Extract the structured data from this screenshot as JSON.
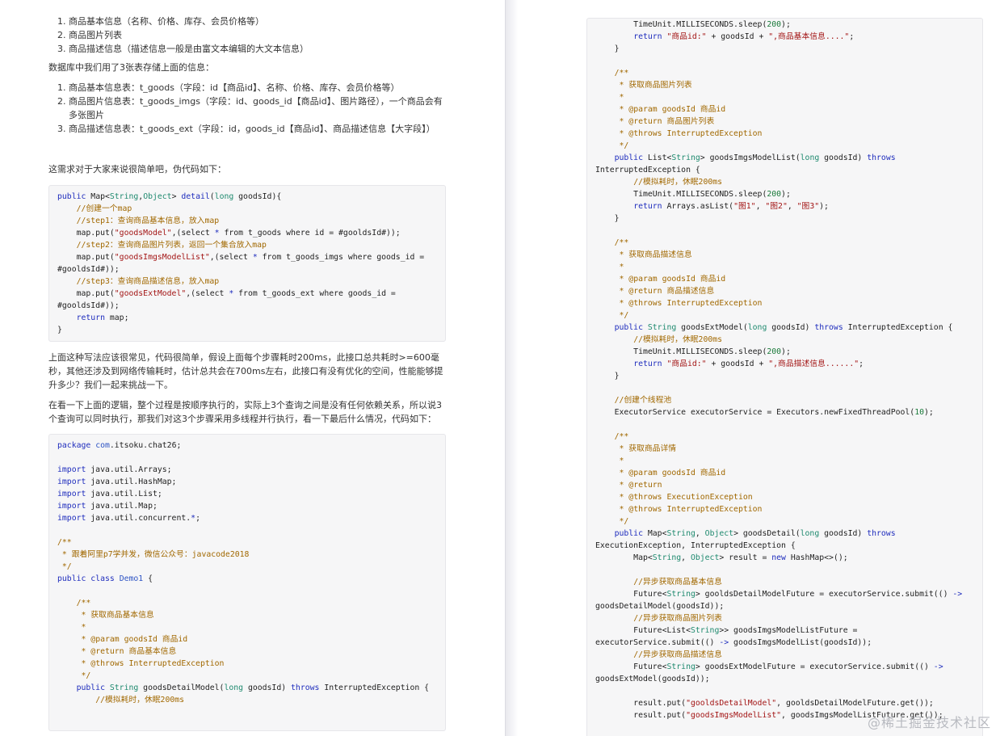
{
  "left": {
    "list1": [
      "商品基本信息（名称、价格、库存、会员价格等）",
      "商品图片列表",
      "商品描述信息（描述信息一般是由富文本编辑的大文本信息）"
    ],
    "db_intro": "数据库中我们用了3张表存储上面的信息：",
    "list2": [
      "商品基本信息表：t_goods（字段：id【商品id】、名称、价格、库存、会员价格等）",
      "商品图片信息表：t_goods_imgs（字段：id、goods_id【商品id】、图片路径），一个商品会有多张图片",
      "商品描述信息表：t_goods_ext（字段：id，goods_id【商品id】、商品描述信息【大字段】）"
    ],
    "simple_intro": "这需求对于大家来说很简单吧，伪代码如下：",
    "code1": [
      [
        [
          "kw",
          "public "
        ],
        [
          "",
          "Map<"
        ],
        [
          "ty",
          "String"
        ],
        [
          "",
          ","
        ],
        [
          "ty",
          "Object"
        ],
        [
          "",
          "> "
        ],
        [
          "kw",
          "detail"
        ],
        [
          "",
          "("
        ],
        [
          "ty",
          "long"
        ],
        [
          "",
          " goodsId){"
        ]
      ],
      [
        [
          "",
          "    "
        ],
        [
          "cm",
          "//创建一个map"
        ]
      ],
      [
        [
          "",
          "    "
        ],
        [
          "cm",
          "//step1：查询商品基本信息，放入map"
        ]
      ],
      [
        [
          "",
          "    map.put("
        ],
        [
          "st",
          "\"goodsModel\""
        ],
        [
          "",
          ",(select "
        ],
        [
          "kw",
          "*"
        ],
        [
          "",
          " from t_goods where id = #gooldsId#));"
        ]
      ],
      [
        [
          "",
          "    "
        ],
        [
          "cm",
          "//step2：查询商品图片列表，返回一个集合放入map"
        ]
      ],
      [
        [
          "",
          "    map.put("
        ],
        [
          "st",
          "\"goodsImgsModelList\""
        ],
        [
          "",
          ",(select "
        ],
        [
          "kw",
          "*"
        ],
        [
          "",
          " from t_goods_imgs where goods_id ="
        ]
      ],
      [
        [
          "",
          "#gooldsId#));"
        ]
      ],
      [
        [
          "",
          "    "
        ],
        [
          "cm",
          "//step3：查询商品描述信息，放入map"
        ]
      ],
      [
        [
          "",
          "    map.put("
        ],
        [
          "st",
          "\"goodsExtModel\""
        ],
        [
          "",
          ",(select "
        ],
        [
          "kw",
          "*"
        ],
        [
          "",
          " from t_goods_ext where goods_id ="
        ]
      ],
      [
        [
          "",
          "#gooldsId#));"
        ]
      ],
      [
        [
          "",
          "    "
        ],
        [
          "kw",
          "return"
        ],
        [
          "",
          " map;"
        ]
      ],
      [
        [
          "",
          "}"
        ]
      ]
    ],
    "para1": "上面这种写法应该很常见，代码很简单，假设上面每个步骤耗时200ms，此接口总共耗时>=600毫秒，其他还涉及到网络传输耗时，估计总共会在700ms左右，此接口有没有优化的空间，性能能够提升多少？我们一起来挑战一下。",
    "para2": "在看一下上面的逻辑，整个过程是按顺序执行的，实际上3个查询之间是没有任何依赖关系，所以说3个查询可以同时执行，那我们对这3个步骤采用多线程并行执行，看一下最后什么情况，代码如下：",
    "code2": [
      [
        [
          "kw",
          "package "
        ],
        [
          "cn",
          "com"
        ],
        [
          "",
          ".itsoku.chat26;"
        ]
      ],
      [
        [
          "",
          ""
        ]
      ],
      [
        [
          "kw",
          "import"
        ],
        [
          "",
          " java.util.Arrays;"
        ]
      ],
      [
        [
          "kw",
          "import"
        ],
        [
          "",
          " java.util.HashMap;"
        ]
      ],
      [
        [
          "kw",
          "import"
        ],
        [
          "",
          " java.util.List;"
        ]
      ],
      [
        [
          "kw",
          "import"
        ],
        [
          "",
          " java.util.Map;"
        ]
      ],
      [
        [
          "kw",
          "import"
        ],
        [
          "",
          " java.util.concurrent."
        ],
        [
          "kw",
          "*"
        ],
        [
          "",
          ";"
        ]
      ],
      [
        [
          "",
          ""
        ]
      ],
      [
        [
          "cm",
          "/**"
        ]
      ],
      [
        [
          "cm",
          " * 跟着阿里p7学并发，微信公众号：javacode2018"
        ]
      ],
      [
        [
          "cm",
          " */"
        ]
      ],
      [
        [
          "kw",
          "public class "
        ],
        [
          "cn",
          "Demo1"
        ],
        [
          "",
          " {"
        ]
      ],
      [
        [
          "",
          ""
        ]
      ],
      [
        [
          "",
          "    "
        ],
        [
          "cm",
          "/**"
        ]
      ],
      [
        [
          "",
          "     "
        ],
        [
          "cm",
          "* 获取商品基本信息"
        ]
      ],
      [
        [
          "",
          "     "
        ],
        [
          "cm",
          "*"
        ]
      ],
      [
        [
          "",
          "     "
        ],
        [
          "cm",
          "* @param goodsId 商品id"
        ]
      ],
      [
        [
          "",
          "     "
        ],
        [
          "cm",
          "* @return 商品基本信息"
        ]
      ],
      [
        [
          "",
          "     "
        ],
        [
          "cm",
          "* @throws InterruptedException"
        ]
      ],
      [
        [
          "",
          "     "
        ],
        [
          "cm",
          "*/"
        ]
      ],
      [
        [
          "",
          "    "
        ],
        [
          "kw",
          "public "
        ],
        [
          "ty",
          "String"
        ],
        [
          "",
          " goodsDetailModel("
        ],
        [
          "ty",
          "long"
        ],
        [
          "",
          " goodsId) "
        ],
        [
          "kw",
          "throws"
        ],
        [
          "",
          " InterruptedException {"
        ]
      ],
      [
        [
          "",
          "        "
        ],
        [
          "cm",
          "//模拟耗时，休眠200ms"
        ]
      ]
    ]
  },
  "right": {
    "code": [
      [
        [
          "",
          "        TimeUnit.MILLISECONDS.sleep("
        ],
        [
          "num",
          "200"
        ],
        [
          "",
          ");"
        ]
      ],
      [
        [
          "",
          "        "
        ],
        [
          "kw",
          "return "
        ],
        [
          "st",
          "\"商品id:\""
        ],
        [
          "",
          " + goodsId + "
        ],
        [
          "st",
          "\",商品基本信息....\""
        ],
        [
          "",
          ";"
        ]
      ],
      [
        [
          "",
          "    }"
        ]
      ],
      [
        [
          "",
          ""
        ]
      ],
      [
        [
          "",
          "    "
        ],
        [
          "cm",
          "/**"
        ]
      ],
      [
        [
          "",
          "     "
        ],
        [
          "cm",
          "* 获取商品图片列表"
        ]
      ],
      [
        [
          "",
          "     "
        ],
        [
          "cm",
          "*"
        ]
      ],
      [
        [
          "",
          "     "
        ],
        [
          "cm",
          "* @param goodsId 商品id"
        ]
      ],
      [
        [
          "",
          "     "
        ],
        [
          "cm",
          "* @return 商品图片列表"
        ]
      ],
      [
        [
          "",
          "     "
        ],
        [
          "cm",
          "* @throws InterruptedException"
        ]
      ],
      [
        [
          "",
          "     "
        ],
        [
          "cm",
          "*/"
        ]
      ],
      [
        [
          "",
          "    "
        ],
        [
          "kw",
          "public "
        ],
        [
          "",
          "List<"
        ],
        [
          "ty",
          "String"
        ],
        [
          "",
          "> goodsImgsModelList("
        ],
        [
          "ty",
          "long"
        ],
        [
          "",
          " goodsId) "
        ],
        [
          "kw",
          "throws"
        ]
      ],
      [
        [
          "",
          "InterruptedException {"
        ]
      ],
      [
        [
          "",
          "        "
        ],
        [
          "cm",
          "//模拟耗时，休眠200ms"
        ]
      ],
      [
        [
          "",
          "        TimeUnit.MILLISECONDS.sleep("
        ],
        [
          "num",
          "200"
        ],
        [
          "",
          ");"
        ]
      ],
      [
        [
          "",
          "        "
        ],
        [
          "kw",
          "return"
        ],
        [
          "",
          " Arrays.asList("
        ],
        [
          "st",
          "\"图1\""
        ],
        [
          "",
          ", "
        ],
        [
          "st",
          "\"图2\""
        ],
        [
          "",
          ", "
        ],
        [
          "st",
          "\"图3\""
        ],
        [
          "",
          ");"
        ]
      ],
      [
        [
          "",
          "    }"
        ]
      ],
      [
        [
          "",
          ""
        ]
      ],
      [
        [
          "",
          "    "
        ],
        [
          "cm",
          "/**"
        ]
      ],
      [
        [
          "",
          "     "
        ],
        [
          "cm",
          "* 获取商品描述信息"
        ]
      ],
      [
        [
          "",
          "     "
        ],
        [
          "cm",
          "*"
        ]
      ],
      [
        [
          "",
          "     "
        ],
        [
          "cm",
          "* @param goodsId 商品id"
        ]
      ],
      [
        [
          "",
          "     "
        ],
        [
          "cm",
          "* @return 商品描述信息"
        ]
      ],
      [
        [
          "",
          "     "
        ],
        [
          "cm",
          "* @throws InterruptedException"
        ]
      ],
      [
        [
          "",
          "     "
        ],
        [
          "cm",
          "*/"
        ]
      ],
      [
        [
          "",
          "    "
        ],
        [
          "kw",
          "public "
        ],
        [
          "ty",
          "String"
        ],
        [
          "",
          " goodsExtModel("
        ],
        [
          "ty",
          "long"
        ],
        [
          "",
          " goodsId) "
        ],
        [
          "kw",
          "throws"
        ],
        [
          "",
          " InterruptedException {"
        ]
      ],
      [
        [
          "",
          "        "
        ],
        [
          "cm",
          "//模拟耗时，休眠200ms"
        ]
      ],
      [
        [
          "",
          "        TimeUnit.MILLISECONDS.sleep("
        ],
        [
          "num",
          "200"
        ],
        [
          "",
          ");"
        ]
      ],
      [
        [
          "",
          "        "
        ],
        [
          "kw",
          "return "
        ],
        [
          "st",
          "\"商品id:\""
        ],
        [
          "",
          " + goodsId + "
        ],
        [
          "st",
          "\",商品描述信息......\""
        ],
        [
          "",
          ";"
        ]
      ],
      [
        [
          "",
          "    }"
        ]
      ],
      [
        [
          "",
          ""
        ]
      ],
      [
        [
          "",
          "    "
        ],
        [
          "cm",
          "//创建个线程池"
        ]
      ],
      [
        [
          "",
          "    ExecutorService executorService = Executors.newFixedThreadPool("
        ],
        [
          "num",
          "10"
        ],
        [
          "",
          ");"
        ]
      ],
      [
        [
          "",
          ""
        ]
      ],
      [
        [
          "",
          "    "
        ],
        [
          "cm",
          "/**"
        ]
      ],
      [
        [
          "",
          "     "
        ],
        [
          "cm",
          "* 获取商品详情"
        ]
      ],
      [
        [
          "",
          "     "
        ],
        [
          "cm",
          "*"
        ]
      ],
      [
        [
          "",
          "     "
        ],
        [
          "cm",
          "* @param goodsId 商品id"
        ]
      ],
      [
        [
          "",
          "     "
        ],
        [
          "cm",
          "* @return"
        ]
      ],
      [
        [
          "",
          "     "
        ],
        [
          "cm",
          "* @throws ExecutionException"
        ]
      ],
      [
        [
          "",
          "     "
        ],
        [
          "cm",
          "* @throws InterruptedException"
        ]
      ],
      [
        [
          "",
          "     "
        ],
        [
          "cm",
          "*/"
        ]
      ],
      [
        [
          "",
          "    "
        ],
        [
          "kw",
          "public "
        ],
        [
          "",
          "Map<"
        ],
        [
          "ty",
          "String"
        ],
        [
          "",
          ", "
        ],
        [
          "ty",
          "Object"
        ],
        [
          "",
          "> goodsDetail("
        ],
        [
          "ty",
          "long"
        ],
        [
          "",
          " goodsId) "
        ],
        [
          "kw",
          "throws"
        ]
      ],
      [
        [
          "",
          "ExecutionException, InterruptedException {"
        ]
      ],
      [
        [
          "",
          "        Map<"
        ],
        [
          "ty",
          "String"
        ],
        [
          "",
          ", "
        ],
        [
          "ty",
          "Object"
        ],
        [
          "",
          "> result = "
        ],
        [
          "kw",
          "new"
        ],
        [
          "",
          " HashMap<>();"
        ]
      ],
      [
        [
          "",
          ""
        ]
      ],
      [
        [
          "",
          "        "
        ],
        [
          "cm",
          "//异步获取商品基本信息"
        ]
      ],
      [
        [
          "",
          "        Future<"
        ],
        [
          "ty",
          "String"
        ],
        [
          "",
          "> gooldsDetailModelFuture = executorService.submit(() "
        ],
        [
          "kw",
          "->"
        ]
      ],
      [
        [
          "",
          "goodsDetailModel(goodsId));"
        ]
      ],
      [
        [
          "",
          "        "
        ],
        [
          "cm",
          "//异步获取商品图片列表"
        ]
      ],
      [
        [
          "",
          "        Future<List<"
        ],
        [
          "ty",
          "String"
        ],
        [
          "",
          ">> goodsImgsModelListFuture ="
        ]
      ],
      [
        [
          "",
          "executorService.submit(() "
        ],
        [
          "kw",
          "->"
        ],
        [
          "",
          " goodsImgsModelList(goodsId));"
        ]
      ],
      [
        [
          "",
          "        "
        ],
        [
          "cm",
          "//异步获取商品描述信息"
        ]
      ],
      [
        [
          "",
          "        Future<"
        ],
        [
          "ty",
          "String"
        ],
        [
          "",
          "> goodsExtModelFuture = executorService.submit(() "
        ],
        [
          "kw",
          "->"
        ]
      ],
      [
        [
          "",
          "goodsExtModel(goodsId));"
        ]
      ],
      [
        [
          "",
          ""
        ]
      ],
      [
        [
          "",
          "        result.put("
        ],
        [
          "st",
          "\"gooldsDetailModel\""
        ],
        [
          "",
          ", gooldsDetailModelFuture.get());"
        ]
      ],
      [
        [
          "",
          "        result.put("
        ],
        [
          "st",
          "\"goodsImgsModelList\""
        ],
        [
          "",
          ", goodsImgsModelListFuture.get());"
        ]
      ]
    ]
  },
  "watermark": "@稀土掘金技术社区",
  "colors": {
    "keyword": "#1f2dbd",
    "type": "#1f8a6f",
    "string": "#a31515",
    "comment": "#a16800",
    "number": "#1a7a3a",
    "code_bg": "#f6f6f7"
  }
}
